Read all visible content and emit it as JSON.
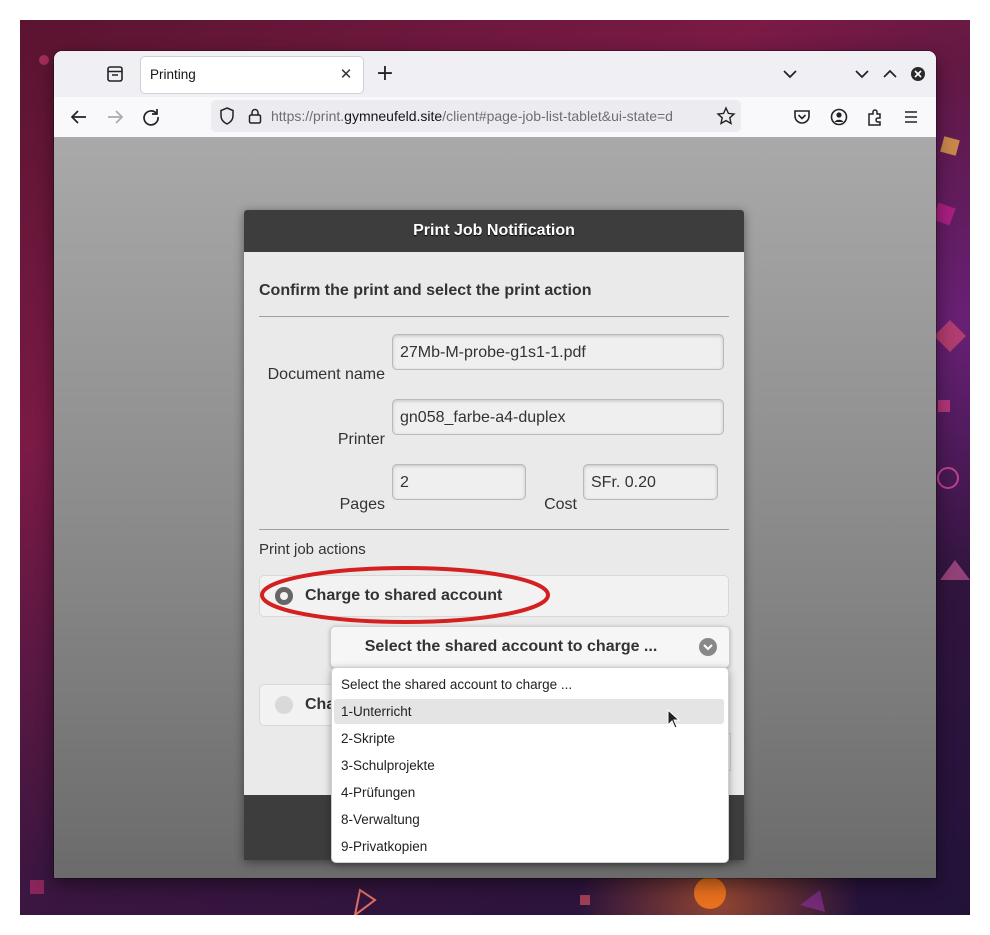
{
  "browser": {
    "tab_title": "Printing",
    "tab_close": "✕",
    "new_tab": "+",
    "url_prefix": "https://print.",
    "url_host": "gymneufeld.site",
    "url_suffix": "/client#page-job-list-tablet&ui-state=d"
  },
  "dialog": {
    "title": "Print Job Notification",
    "heading": "Confirm the print and select the print action",
    "fields": {
      "document_label": "Document name",
      "document_value": "27Mb-M-probe-g1s1-1.pdf",
      "printer_label": "Printer",
      "printer_value": "gn058_farbe-a4-duplex",
      "pages_label": "Pages",
      "pages_value": "2",
      "cost_label": "Cost",
      "cost_value": "SFr. 0.20"
    },
    "actions_label": "Print job actions",
    "radio_shared": "Charge to shared account",
    "radio_second": "Cha",
    "shared_select_value": "Select the shared account to charge ...",
    "dropdown_options": [
      "Select the shared account to charge ...",
      "1-Unterricht",
      "2-Skripte",
      "3-Schulprojekte",
      "4-Prüfungen",
      "8-Verwaltung",
      "9-Privatkopien"
    ],
    "highlighted_option": "1-Unterricht"
  },
  "colors": {
    "annotation_ellipse": "#d42020",
    "dialog_header": "#3d3d3d",
    "dialog_body": "#eaeaea"
  },
  "icons": [
    "tab-list-icon",
    "close-icon",
    "plus-icon",
    "chevron-down-icon",
    "minimize-icon",
    "maximize-icon",
    "window-close-icon",
    "back-arrow-icon",
    "forward-arrow-icon",
    "reload-icon",
    "shield-icon",
    "lock-icon",
    "star-icon",
    "pocket-icon",
    "account-icon",
    "extensions-icon",
    "menu-icon",
    "select-arrow-icon",
    "mouse-cursor-icon"
  ]
}
